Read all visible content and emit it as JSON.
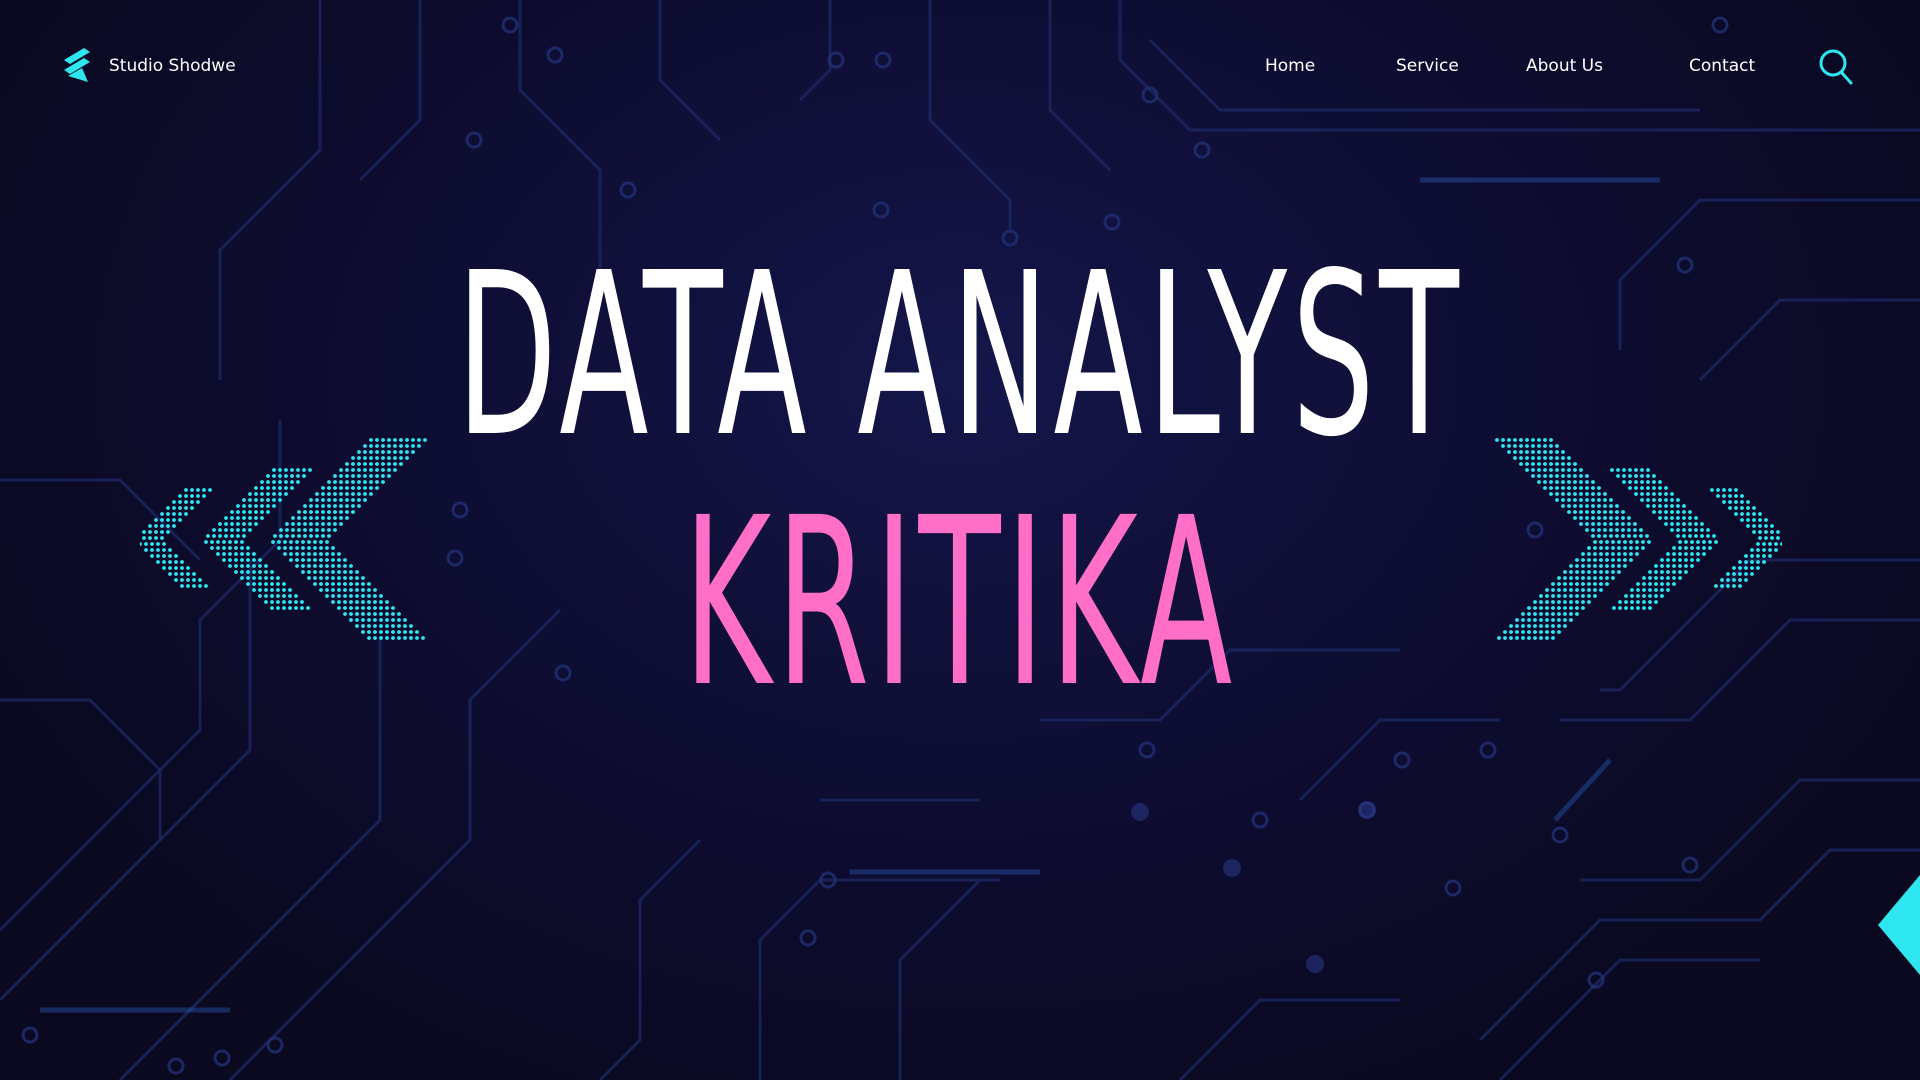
{
  "brand": {
    "name": "Studio Shodwe",
    "logo_icon": "stacked-chevron-logo-icon"
  },
  "nav": {
    "links": [
      "Home",
      "Service",
      "About Us",
      "Contact"
    ],
    "search_icon": "search-icon"
  },
  "hero": {
    "title": "DATA ANALYST",
    "name": "KRITIKA"
  },
  "colors": {
    "background": "#0b0a22",
    "accent": "#2ee6f0",
    "name_pink": "#ff6ec7",
    "text": "#ffffff"
  }
}
